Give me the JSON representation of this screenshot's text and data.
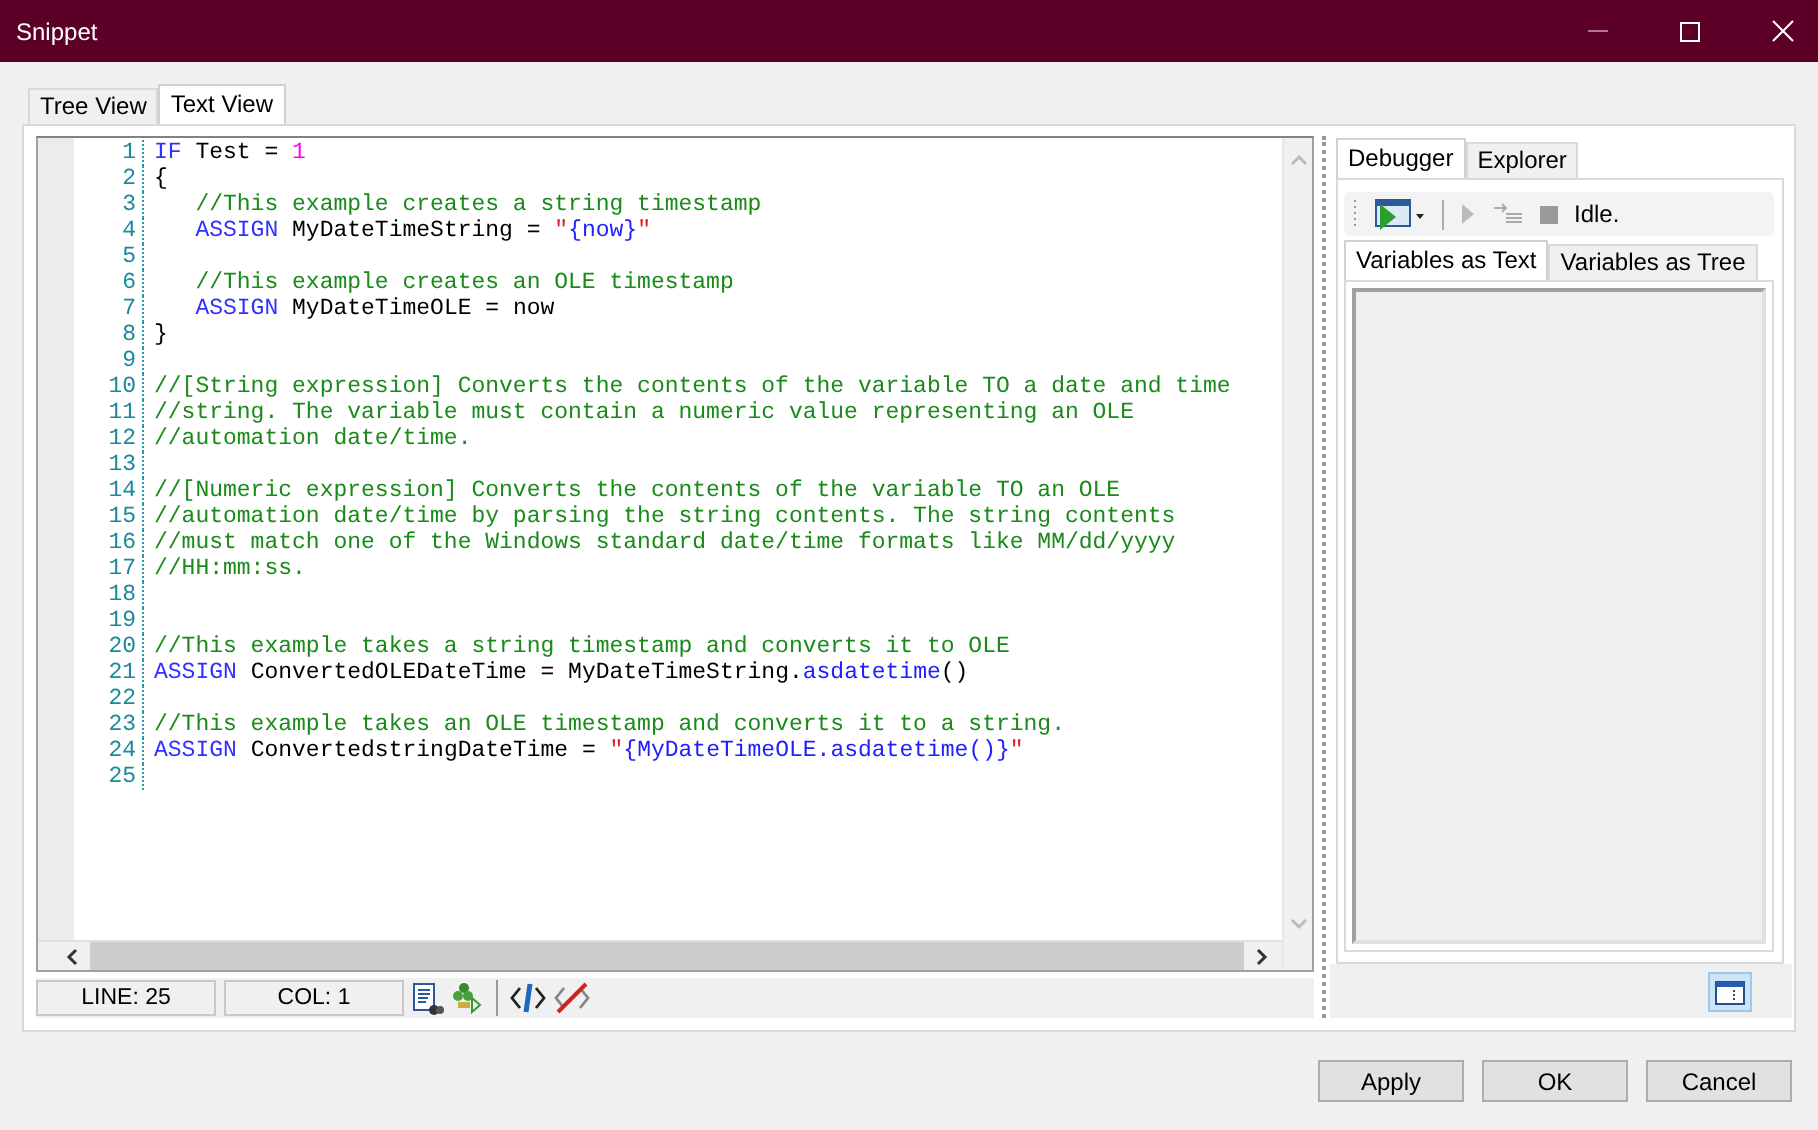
{
  "window": {
    "title": "Snippet"
  },
  "tabs": [
    {
      "label": "Tree View",
      "selected": false
    },
    {
      "label": "Text View",
      "selected": true
    }
  ],
  "code_lines": [
    {
      "number": "1",
      "tokens": [
        {
          "kind": "keyword",
          "text": "IF"
        },
        {
          "kind": "plain",
          "text": " Test = "
        },
        {
          "kind": "number",
          "text": "1"
        }
      ]
    },
    {
      "number": "2",
      "tokens": [
        {
          "kind": "plain",
          "text": "{"
        }
      ]
    },
    {
      "number": "3",
      "tokens": [
        {
          "kind": "comment",
          "text": "   //This example creates a string timestamp"
        }
      ]
    },
    {
      "number": "4",
      "tokens": [
        {
          "kind": "keyword",
          "text": "   ASSIGN"
        },
        {
          "kind": "plain",
          "text": " MyDateTimeString = "
        },
        {
          "kind": "string",
          "text": "\""
        },
        {
          "kind": "expression",
          "text": "{now}"
        },
        {
          "kind": "string",
          "text": "\""
        }
      ]
    },
    {
      "number": "5"
    },
    {
      "number": "6",
      "tokens": [
        {
          "kind": "comment",
          "text": "   //This example creates an OLE timestamp"
        }
      ]
    },
    {
      "number": "7",
      "tokens": [
        {
          "kind": "keyword",
          "text": "   ASSIGN"
        },
        {
          "kind": "plain",
          "text": " MyDateTimeOLE = now"
        }
      ]
    },
    {
      "number": "8",
      "tokens": [
        {
          "kind": "plain",
          "text": "}"
        }
      ]
    },
    {
      "number": "9"
    },
    {
      "number": "10",
      "tokens": [
        {
          "kind": "comment",
          "text": "//[String expression] Converts the contents of the variable TO a date and time"
        }
      ]
    },
    {
      "number": "11",
      "tokens": [
        {
          "kind": "comment",
          "text": "//string. The variable must contain a numeric value representing an OLE"
        }
      ]
    },
    {
      "number": "12",
      "tokens": [
        {
          "kind": "comment",
          "text": "//automation date/time."
        }
      ]
    },
    {
      "number": "13"
    },
    {
      "number": "14",
      "tokens": [
        {
          "kind": "comment",
          "text": "//[Numeric expression] Converts the contents of the variable TO an OLE"
        }
      ]
    },
    {
      "number": "15",
      "tokens": [
        {
          "kind": "comment",
          "text": "//automation date/time by parsing the string contents. The string contents"
        }
      ]
    },
    {
      "number": "16",
      "tokens": [
        {
          "kind": "comment",
          "text": "//must match one of the Windows standard date/time formats like MM/dd/yyyy"
        }
      ]
    },
    {
      "number": "17",
      "tokens": [
        {
          "kind": "comment",
          "text": "//HH:mm:ss."
        }
      ]
    },
    {
      "number": "18"
    },
    {
      "number": "19"
    },
    {
      "number": "20",
      "tokens": [
        {
          "kind": "comment",
          "text": "//This example takes a string timestamp and converts it to OLE"
        }
      ]
    },
    {
      "number": "21",
      "tokens": [
        {
          "kind": "keyword",
          "text": "ASSIGN"
        },
        {
          "kind": "plain",
          "text": " ConvertedOLEDateTime = MyDateTimeString."
        },
        {
          "kind": "expression",
          "text": "asdatetime"
        },
        {
          "kind": "plain",
          "text": "()"
        }
      ]
    },
    {
      "number": "22"
    },
    {
      "number": "23",
      "tokens": [
        {
          "kind": "comment",
          "text": "//This example takes an OLE timestamp and converts it to a string."
        }
      ]
    },
    {
      "number": "24",
      "tokens": [
        {
          "kind": "keyword",
          "text": "ASSIGN"
        },
        {
          "kind": "plain",
          "text": " ConvertedstringDateTime = "
        },
        {
          "kind": "string",
          "text": "\""
        },
        {
          "kind": "expression",
          "text": "{MyDateTimeOLE.asdatetime()}"
        },
        {
          "kind": "string",
          "text": "\""
        }
      ]
    },
    {
      "number": "25"
    }
  ],
  "status_bar": {
    "line": "LINE: 25",
    "column": "COL: 1"
  },
  "side_tabs": [
    {
      "label": "Debugger",
      "selected": true
    },
    {
      "label": "Explorer",
      "selected": false
    }
  ],
  "debugger": {
    "status": "Idle."
  },
  "variable_tabs": [
    {
      "label": "Variables as Text",
      "selected": true
    },
    {
      "label": "Variables as Tree",
      "selected": false
    }
  ],
  "buttons": [
    "Apply",
    "OK",
    "Cancel"
  ]
}
